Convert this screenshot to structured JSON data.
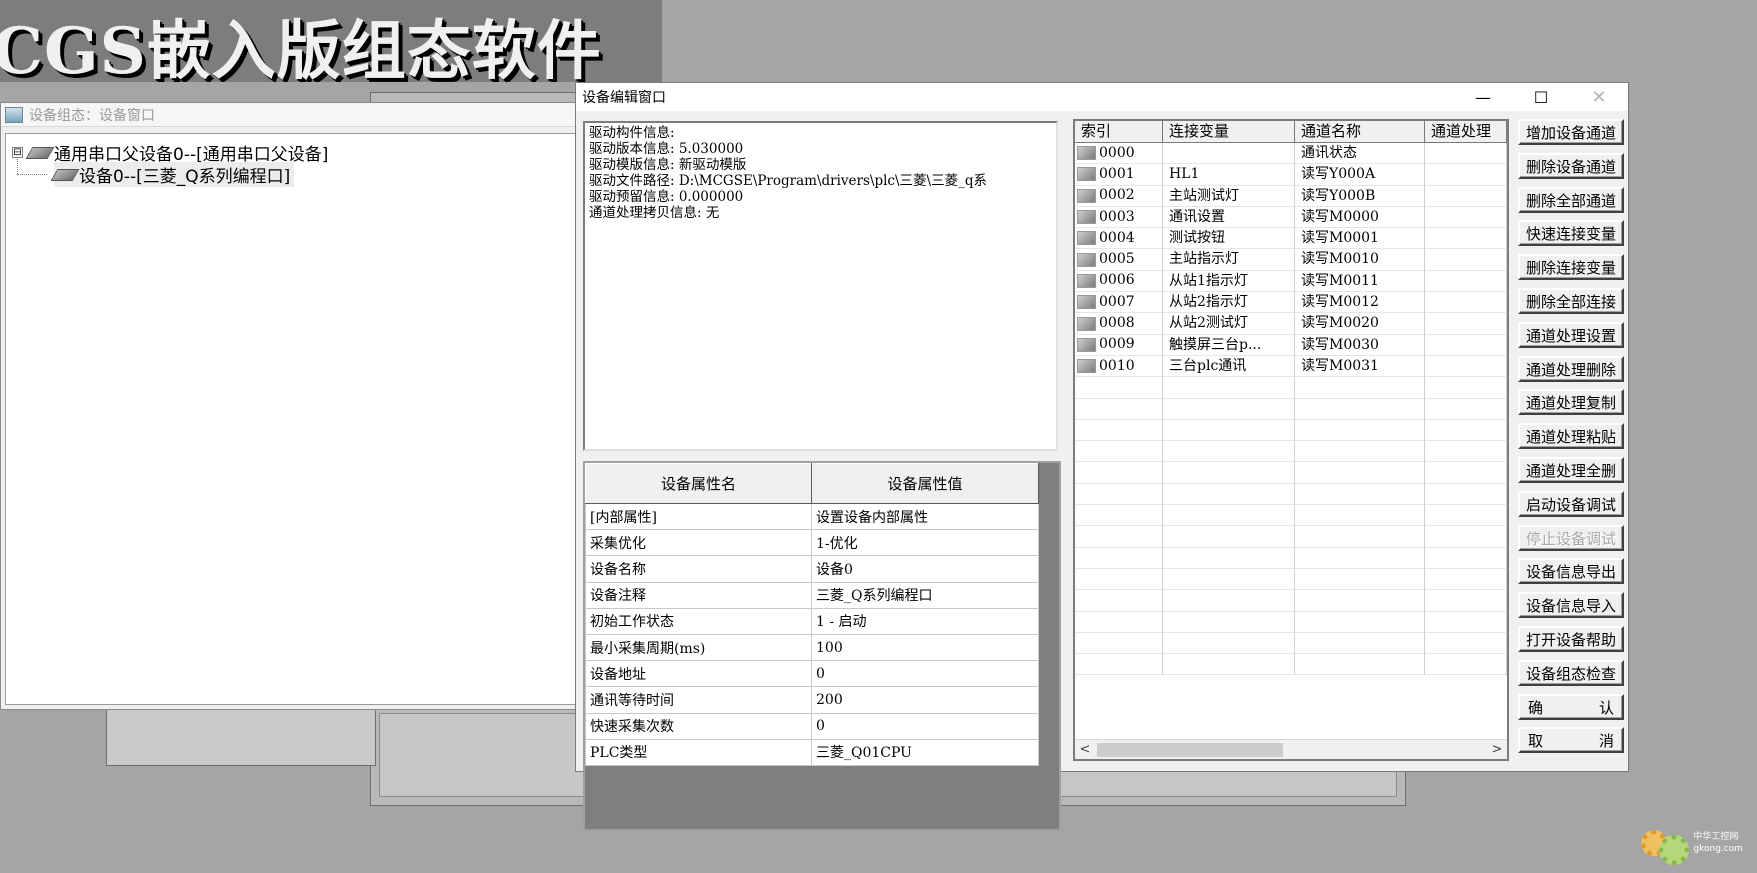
{
  "banner": {
    "text": "CGS嵌入版组态软件"
  },
  "device_window": {
    "title": "设备组态：设备窗口",
    "tree": [
      {
        "label": "通用串口父设备0--[通用串口父设备]",
        "expander": "⊟"
      },
      {
        "label": "设备0--[三菱_Q系列编程口]"
      }
    ]
  },
  "editor": {
    "title": "设备编辑窗口",
    "controls": {
      "minimize": "—",
      "maximize": "☐",
      "close": "✕"
    },
    "info_lines": [
      "驱动构件信息:",
      "驱动版本信息: 5.030000",
      "驱动模版信息: 新驱动模版",
      "驱动文件路径: D:\\MCGSE\\Program\\drivers\\plc\\三菱\\三菱_q系",
      "驱动预留信息: 0.000000",
      "通道处理拷贝信息: 无"
    ],
    "properties": {
      "headers": [
        "设备属性名",
        "设备属性值"
      ],
      "rows": [
        [
          "[内部属性]",
          "设置设备内部属性"
        ],
        [
          "采集优化",
          "1-优化"
        ],
        [
          "设备名称",
          "设备0"
        ],
        [
          "设备注释",
          "三菱_Q系列编程口"
        ],
        [
          "初始工作状态",
          "1 - 启动"
        ],
        [
          "最小采集周期(ms)",
          "100"
        ],
        [
          "设备地址",
          "0"
        ],
        [
          "通讯等待时间",
          "200"
        ],
        [
          "快速采集次数",
          "0"
        ],
        [
          "PLC类型",
          "三菱_Q01CPU"
        ]
      ]
    },
    "channels": {
      "headers": [
        "索引",
        "连接变量",
        "通道名称",
        "通道处理"
      ],
      "rows": [
        [
          "0000",
          "",
          "通讯状态",
          ""
        ],
        [
          "0001",
          "HL1",
          "读写Y000A",
          ""
        ],
        [
          "0002",
          "主站测试灯",
          "读写Y000B",
          ""
        ],
        [
          "0003",
          "通讯设置",
          "读写M0000",
          ""
        ],
        [
          "0004",
          "测试按钮",
          "读写M0001",
          ""
        ],
        [
          "0005",
          "主站指示灯",
          "读写M0010",
          ""
        ],
        [
          "0006",
          "从站1指示灯",
          "读写M0011",
          ""
        ],
        [
          "0007",
          "从站2指示灯",
          "读写M0012",
          ""
        ],
        [
          "0008",
          "从站2测试灯",
          "读写M0020",
          ""
        ],
        [
          "0009",
          "触摸屏三台p...",
          "读写M0030",
          ""
        ],
        [
          "0010",
          "三台plc通讯",
          "读写M0031",
          ""
        ]
      ],
      "scroll_left": "<",
      "scroll_right": ">"
    },
    "buttons": [
      "增加设备通道",
      "删除设备通道",
      "删除全部通道",
      "快速连接变量",
      "删除连接变量",
      "删除全部连接",
      "通道处理设置",
      "通道处理删除",
      "通道处理复制",
      "通道处理粘贴",
      "通道处理全删",
      "启动设备调试",
      "停止设备调试",
      "设备信息导出",
      "设备信息导入",
      "打开设备帮助",
      "设备组态检查"
    ],
    "confirm": {
      "left": "确",
      "right": "认"
    },
    "cancel": {
      "left": "取",
      "right": "消"
    }
  },
  "watermark": {
    "line1": "中华工控网",
    "line2": "gkong.com"
  }
}
